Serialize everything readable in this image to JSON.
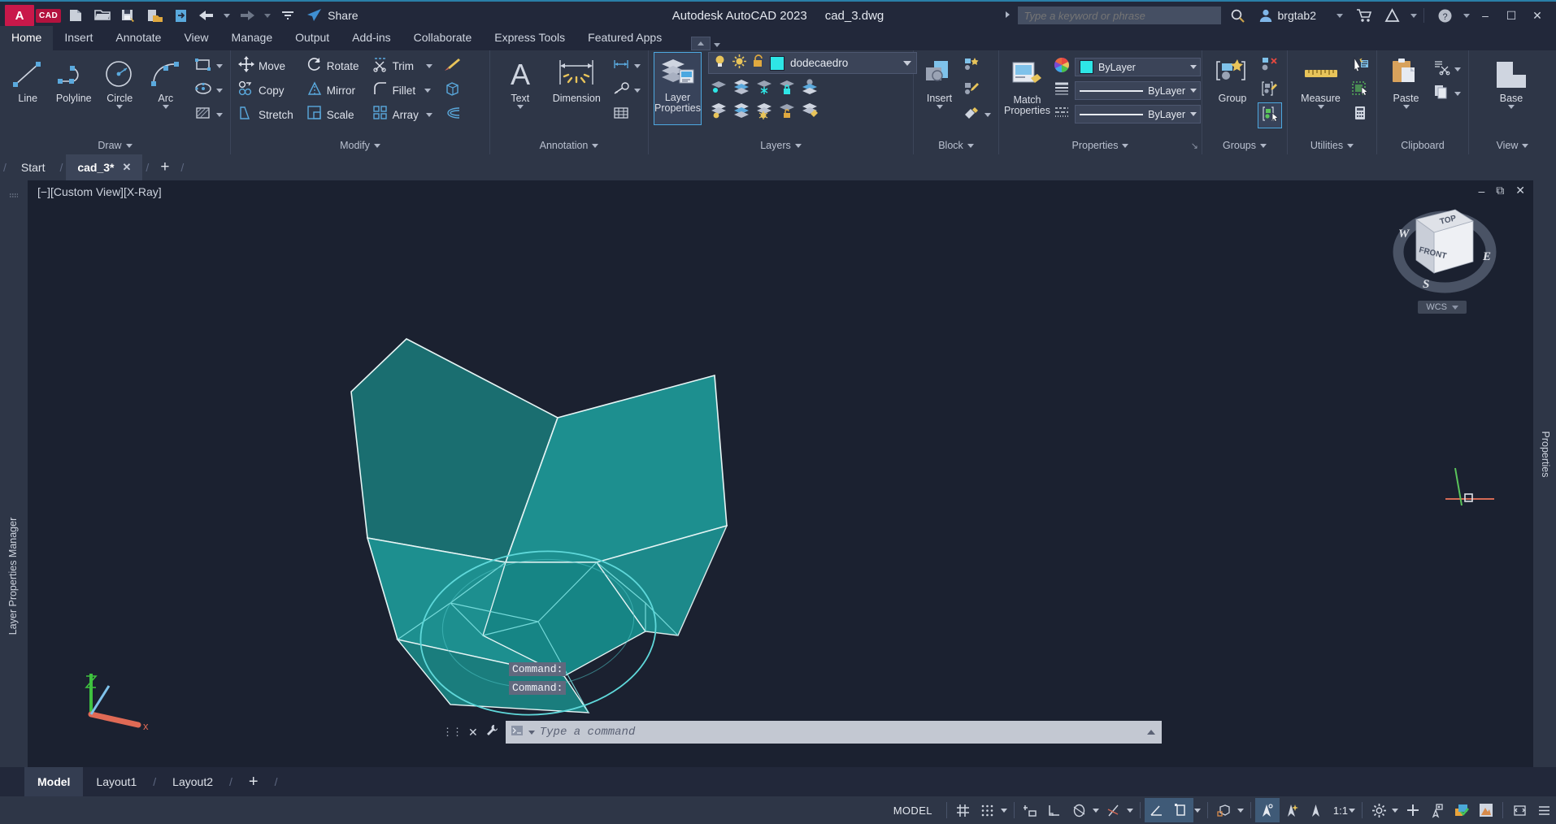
{
  "titlebar": {
    "logo": "A",
    "logo_badge": "CAD",
    "app_title": "Autodesk AutoCAD 2023",
    "file_name": "cad_3.dwg",
    "share_label": "Share",
    "search_placeholder": "Type a keyword or phrase",
    "search_value": "",
    "user_name": "brgtab2",
    "quick_access": [
      {
        "name": "new-file-icon",
        "label": "New"
      },
      {
        "name": "open-file-icon",
        "label": "Open"
      },
      {
        "name": "save-icon",
        "label": "Save"
      },
      {
        "name": "save-as-icon",
        "label": "Save As"
      },
      {
        "name": "plot-icon",
        "label": "Plot"
      },
      {
        "name": "undo-icon",
        "label": "Undo"
      },
      {
        "name": "redo-icon",
        "label": "Redo"
      },
      {
        "name": "customize-icon",
        "label": "Customize"
      }
    ],
    "window_controls": {
      "minimize": "–",
      "maximize": "☐",
      "close": "✕"
    },
    "help_label": "?"
  },
  "ribbon_tabs": [
    {
      "label": "Home",
      "active": true
    },
    {
      "label": "Insert",
      "active": false
    },
    {
      "label": "Annotate",
      "active": false
    },
    {
      "label": "View",
      "active": false
    },
    {
      "label": "Manage",
      "active": false
    },
    {
      "label": "Output",
      "active": false
    },
    {
      "label": "Add-ins",
      "active": false
    },
    {
      "label": "Collaborate",
      "active": false
    },
    {
      "label": "Express Tools",
      "active": false
    },
    {
      "label": "Featured Apps",
      "active": false
    }
  ],
  "ribbon": {
    "draw": {
      "title": "Draw",
      "buttons": [
        {
          "label": "Line",
          "icon": "line-icon"
        },
        {
          "label": "Polyline",
          "icon": "polyline-icon"
        },
        {
          "label": "Circle",
          "icon": "circle-icon"
        },
        {
          "label": "Arc",
          "icon": "arc-icon"
        }
      ],
      "flyouts": [
        {
          "icon": "rectangle-icon"
        },
        {
          "icon": "ellipse-icon"
        },
        {
          "icon": "hatch-icon"
        }
      ]
    },
    "modify": {
      "title": "Modify",
      "items": [
        {
          "label": "Move",
          "icon": "move-icon"
        },
        {
          "label": "Rotate",
          "icon": "rotate-icon"
        },
        {
          "label": "Trim",
          "icon": "trim-icon"
        },
        {
          "label": "Copy",
          "icon": "copy-icon"
        },
        {
          "label": "Mirror",
          "icon": "mirror-icon"
        },
        {
          "label": "Fillet",
          "icon": "fillet-icon"
        },
        {
          "label": "Stretch",
          "icon": "stretch-icon"
        },
        {
          "label": "Scale",
          "icon": "scale-icon"
        },
        {
          "label": "Array",
          "icon": "array-icon"
        }
      ],
      "extras": [
        {
          "icon": "paintbrush-icon"
        },
        {
          "icon": "solid-edit-icon"
        },
        {
          "icon": "offset-icon"
        }
      ]
    },
    "annotation": {
      "title": "Annotation",
      "buttons": [
        {
          "label": "Text",
          "icon": "text-icon"
        },
        {
          "label": "Dimension",
          "icon": "dimension-icon"
        }
      ],
      "extras": [
        {
          "icon": "linear-dimension-icon"
        },
        {
          "icon": "leader-icon"
        },
        {
          "icon": "table-icon"
        }
      ]
    },
    "layers": {
      "title": "Layers",
      "main_button": {
        "label_line1": "Layer",
        "label_line2": "Properties",
        "icon": "layer-properties-icon",
        "active": true
      },
      "current_layer": "dodecaedro",
      "layer_color": "#2ee6e6",
      "tools": [
        {
          "icon": "layer-isolate-icon"
        },
        {
          "icon": "layer-unisolate-icon"
        },
        {
          "icon": "layer-freeze-icon"
        },
        {
          "icon": "layer-lock-icon"
        },
        {
          "icon": "layer-make-current-icon"
        },
        {
          "icon": "layer-off-icon"
        },
        {
          "icon": "layer-turn-on-icon"
        },
        {
          "icon": "layer-thaw-icon"
        },
        {
          "icon": "layer-unlock-icon"
        },
        {
          "icon": "layer-match-icon"
        }
      ]
    },
    "block": {
      "title": "Block",
      "buttons": [
        {
          "label": "Insert",
          "icon": "insert-block-icon"
        }
      ],
      "extras": [
        {
          "icon": "create-block-icon"
        },
        {
          "icon": "edit-block-icon"
        },
        {
          "icon": "edit-attribute-icon"
        }
      ]
    },
    "properties": {
      "title": "Properties",
      "buttons": [
        {
          "label_line1": "Match",
          "label_line2": "Properties",
          "icon": "match-properties-icon"
        }
      ],
      "color": {
        "value": "ByLayer",
        "swatch": "#2ee6e6",
        "icon": "color-wheel-icon"
      },
      "linewidth": {
        "value": "ByLayer",
        "icon": "lineweight-icon"
      },
      "linetype": {
        "value": "ByLayer",
        "icon": "linetype-icon"
      }
    },
    "groups": {
      "title": "Groups",
      "buttons": [
        {
          "label": "Group",
          "icon": "group-icon"
        }
      ],
      "extras": [
        {
          "icon": "ungroup-icon"
        },
        {
          "icon": "group-edit-icon"
        },
        {
          "icon": "group-selection-on-icon"
        }
      ]
    },
    "utilities": {
      "title": "Utilities",
      "buttons": [
        {
          "label": "Measure",
          "icon": "measure-icon"
        }
      ],
      "extras": [
        {
          "icon": "quick-select-icon"
        },
        {
          "icon": "quick-calc-area-icon"
        },
        {
          "icon": "calculator-icon"
        }
      ]
    },
    "clipboard": {
      "title": "Clipboard",
      "buttons": [
        {
          "label": "Paste",
          "icon": "paste-icon"
        }
      ],
      "extras": [
        {
          "icon": "cut-icon"
        },
        {
          "icon": "copy-clip-icon"
        }
      ]
    },
    "view": {
      "title": "View",
      "buttons": [
        {
          "label": "Base",
          "icon": "base-view-icon"
        }
      ]
    }
  },
  "file_tabs": {
    "start_label": "Start",
    "tabs": [
      {
        "label": "cad_3*",
        "active": true,
        "close": "✕"
      }
    ],
    "add_label": "+"
  },
  "viewport": {
    "label": "[−][Custom View][X-Ray]",
    "panel_title": "Layer Properties Manager",
    "right_panel_title": "Properties",
    "navcube": {
      "top": "TOP",
      "front": "FRONT",
      "west": "W",
      "east": "E",
      "south": "S",
      "wcs": "WCS"
    },
    "ucs_axes": {
      "x": "x",
      "y": "y",
      "z": "z"
    },
    "model_color": "#1d8f8f",
    "edge_color": "#bfe9ea"
  },
  "command_line": {
    "history": [
      "Command:",
      "Command:"
    ],
    "placeholder": "Type a command",
    "value": "",
    "close_label": "✕"
  },
  "layout_tabs": [
    {
      "label": "Model",
      "active": true
    },
    {
      "label": "Layout1",
      "active": false
    },
    {
      "label": "Layout2",
      "active": false
    },
    {
      "label": "+",
      "active": false
    }
  ],
  "statusbar": {
    "space_label": "MODEL",
    "scale": "1:1",
    "toggles": [
      {
        "name": "grid-display-toggle",
        "on": false
      },
      {
        "name": "snap-mode-toggle",
        "on": false
      },
      {
        "name": "infer-constraints-toggle",
        "on": false
      },
      {
        "name": "ortho-mode-toggle",
        "on": false
      },
      {
        "name": "polar-tracking-toggle",
        "on": false
      },
      {
        "name": "object-snap-tracking-toggle",
        "on": false
      },
      {
        "name": "object-snap-toggle",
        "on": true
      },
      {
        "name": "lineweight-toggle",
        "on": true
      },
      {
        "name": "transparency-toggle",
        "on": false
      },
      {
        "name": "selection-cycling-toggle",
        "on": true
      },
      {
        "name": "3d-object-snap-toggle",
        "on": false
      },
      {
        "name": "dynamic-ucs-toggle",
        "on": false
      },
      {
        "name": "annotation-settings-toggle",
        "on": false
      },
      {
        "name": "isolate-objects-toggle",
        "on": false
      },
      {
        "name": "workspace-switching-toggle",
        "on": false
      },
      {
        "name": "hardware-acceleration-toggle",
        "on": false
      },
      {
        "name": "clean-screen-toggle",
        "on": false
      },
      {
        "name": "customization-menu",
        "on": false
      }
    ]
  }
}
